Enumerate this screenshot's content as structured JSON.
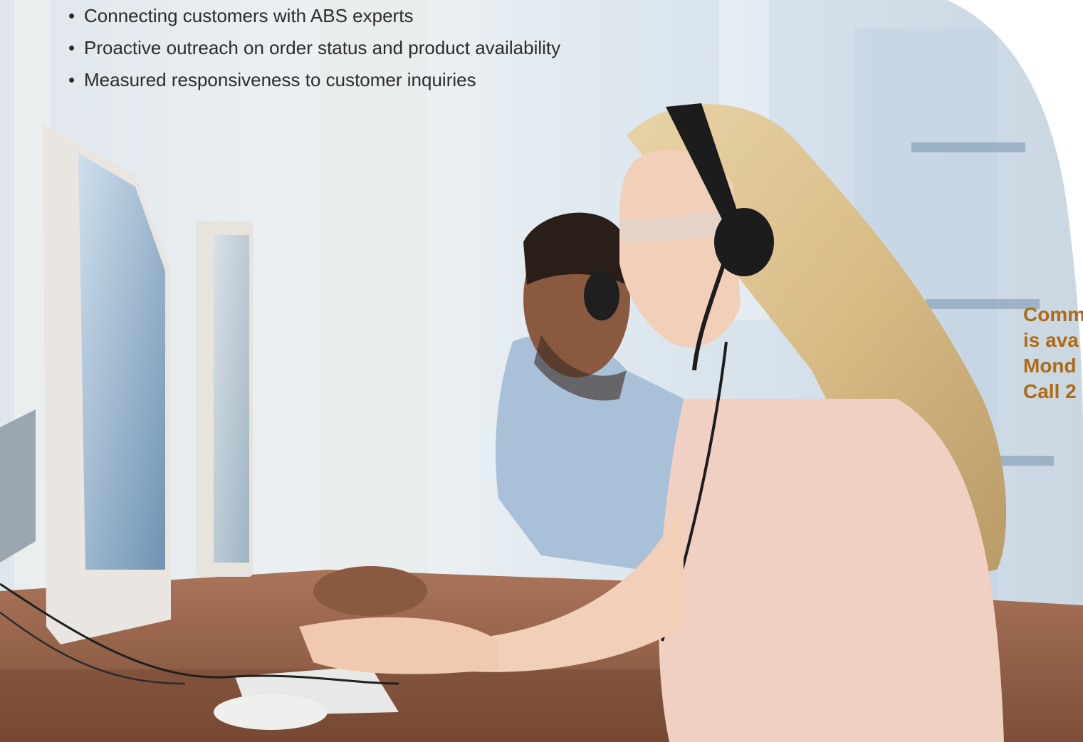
{
  "bullets": [
    "Connecting customers with ABS experts",
    "Proactive outreach on order status and product availability",
    "Measured responsiveness to customer inquiries"
  ],
  "bullet_symbol": "•",
  "callout": {
    "lines": [
      "Comm",
      "is ava",
      "Mond",
      "Call 2"
    ],
    "color": "#b06a12"
  },
  "photo": {
    "subject": "two customer service agents wearing headsets typing at computer workstations"
  }
}
